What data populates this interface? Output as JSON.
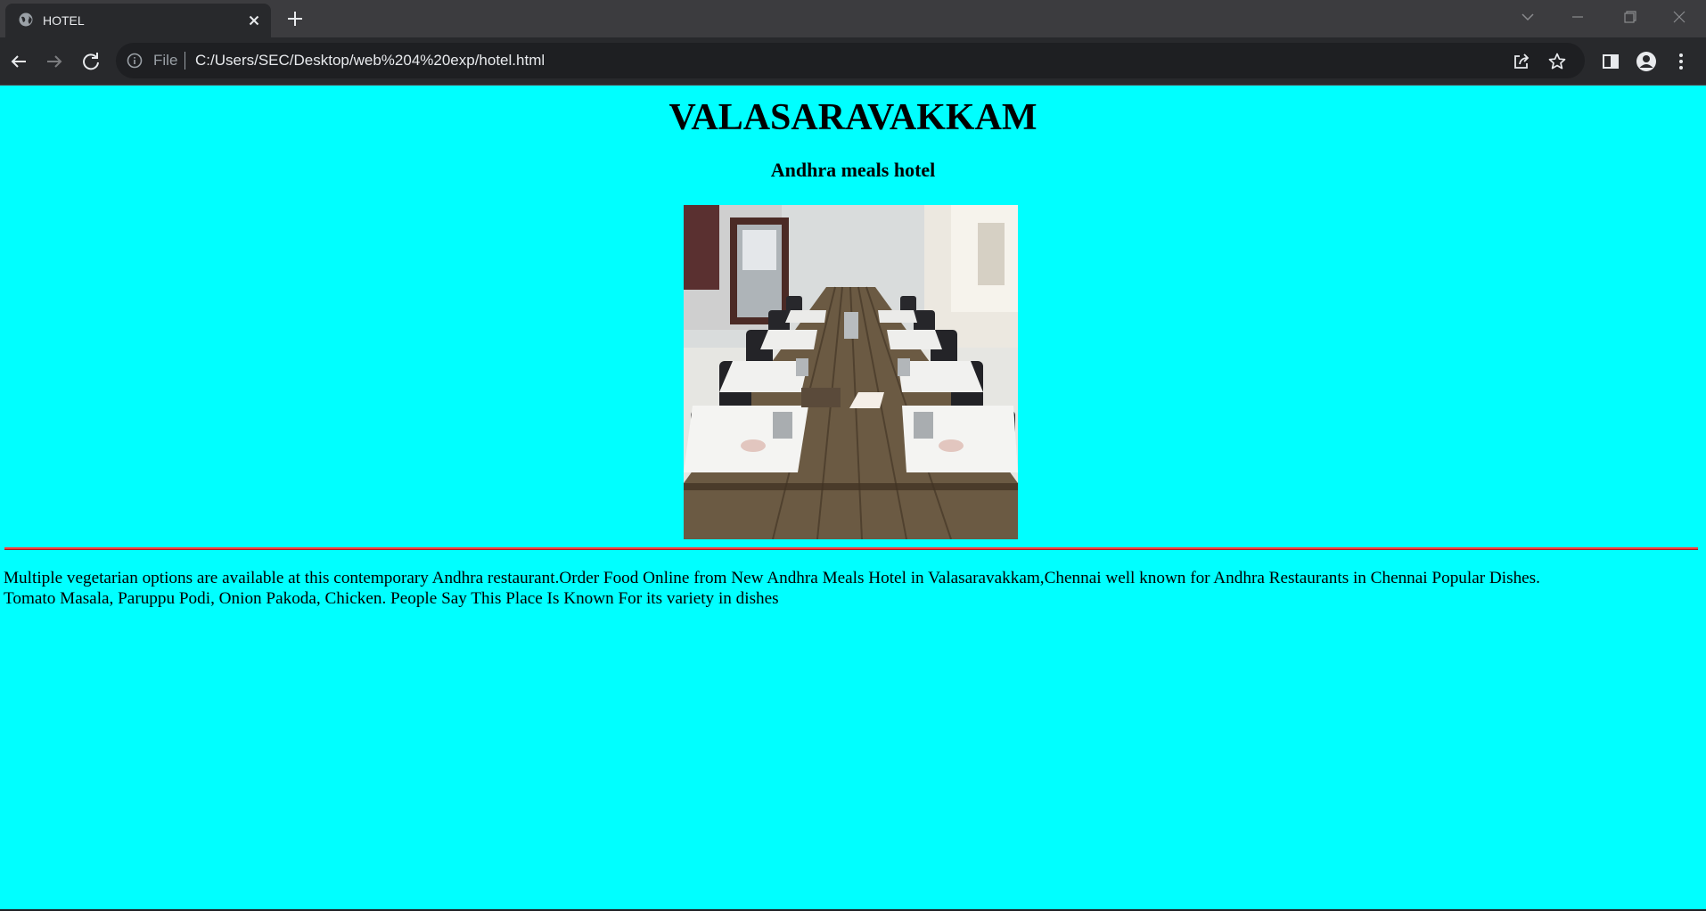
{
  "browser": {
    "tab": {
      "title": "HOTEL",
      "icon": "globe-icon"
    },
    "toolbar": {
      "scheme_label": "File",
      "url": "C:/Users/SEC/Desktop/web%204%20exp/hotel.html"
    },
    "colors": {
      "tabstrip": "#3c3c3f",
      "toolbar": "#28292c",
      "omnibox": "#1e1f22",
      "text": "#e8eaed"
    }
  },
  "page": {
    "heading": "VALASARAVAKKAM",
    "subheading": "Andhra meals hotel",
    "paragraph_line1": "Multiple vegetarian options are available at this contemporary Andhra restaurant.Order Food Online from New Andhra Meals Hotel in Valasaravakkam,Chennai well known for Andhra Restaurants in Chennai Popular Dishes.",
    "paragraph_line2": "Tomato Masala, Paruppu Podi, Onion Pakoda, Chicken. People Say This Place Is Known For its variety in dishes",
    "colors": {
      "background": "#00ffff",
      "rule": "#ff3b3b"
    }
  }
}
